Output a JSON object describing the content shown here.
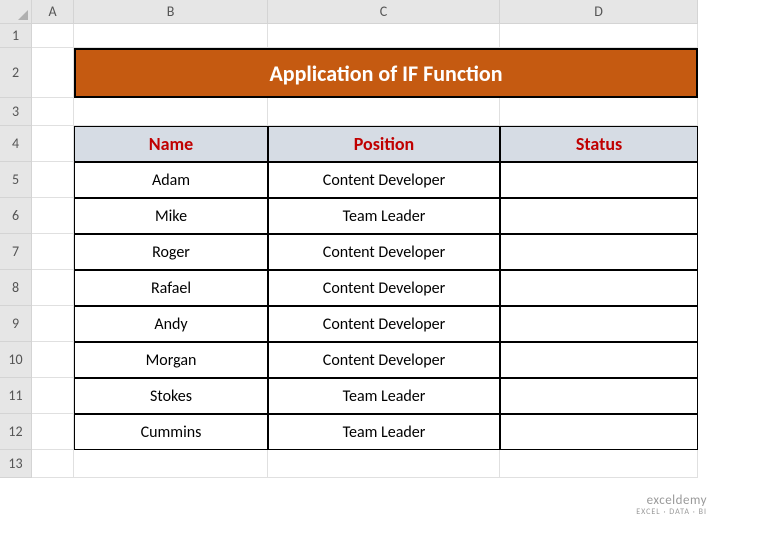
{
  "columns": [
    "A",
    "B",
    "C",
    "D"
  ],
  "rows": [
    "1",
    "2",
    "3",
    "4",
    "5",
    "6",
    "7",
    "8",
    "9",
    "10",
    "11",
    "12",
    "13"
  ],
  "title": "Application of IF Function",
  "table": {
    "headers": [
      "Name",
      "Position",
      "Status"
    ],
    "data": [
      {
        "name": "Adam",
        "position": "Content Developer",
        "status": ""
      },
      {
        "name": "Mike",
        "position": "Team Leader",
        "status": ""
      },
      {
        "name": "Roger",
        "position": "Content Developer",
        "status": ""
      },
      {
        "name": "Rafael",
        "position": "Content Developer",
        "status": ""
      },
      {
        "name": "Andy",
        "position": "Content Developer",
        "status": ""
      },
      {
        "name": "Morgan",
        "position": "Content Developer",
        "status": ""
      },
      {
        "name": "Stokes",
        "position": "Team Leader",
        "status": ""
      },
      {
        "name": "Cummins",
        "position": "Team Leader",
        "status": ""
      }
    ]
  },
  "watermark": {
    "main": "exceldemy",
    "sub": "EXCEL · DATA · BI"
  }
}
